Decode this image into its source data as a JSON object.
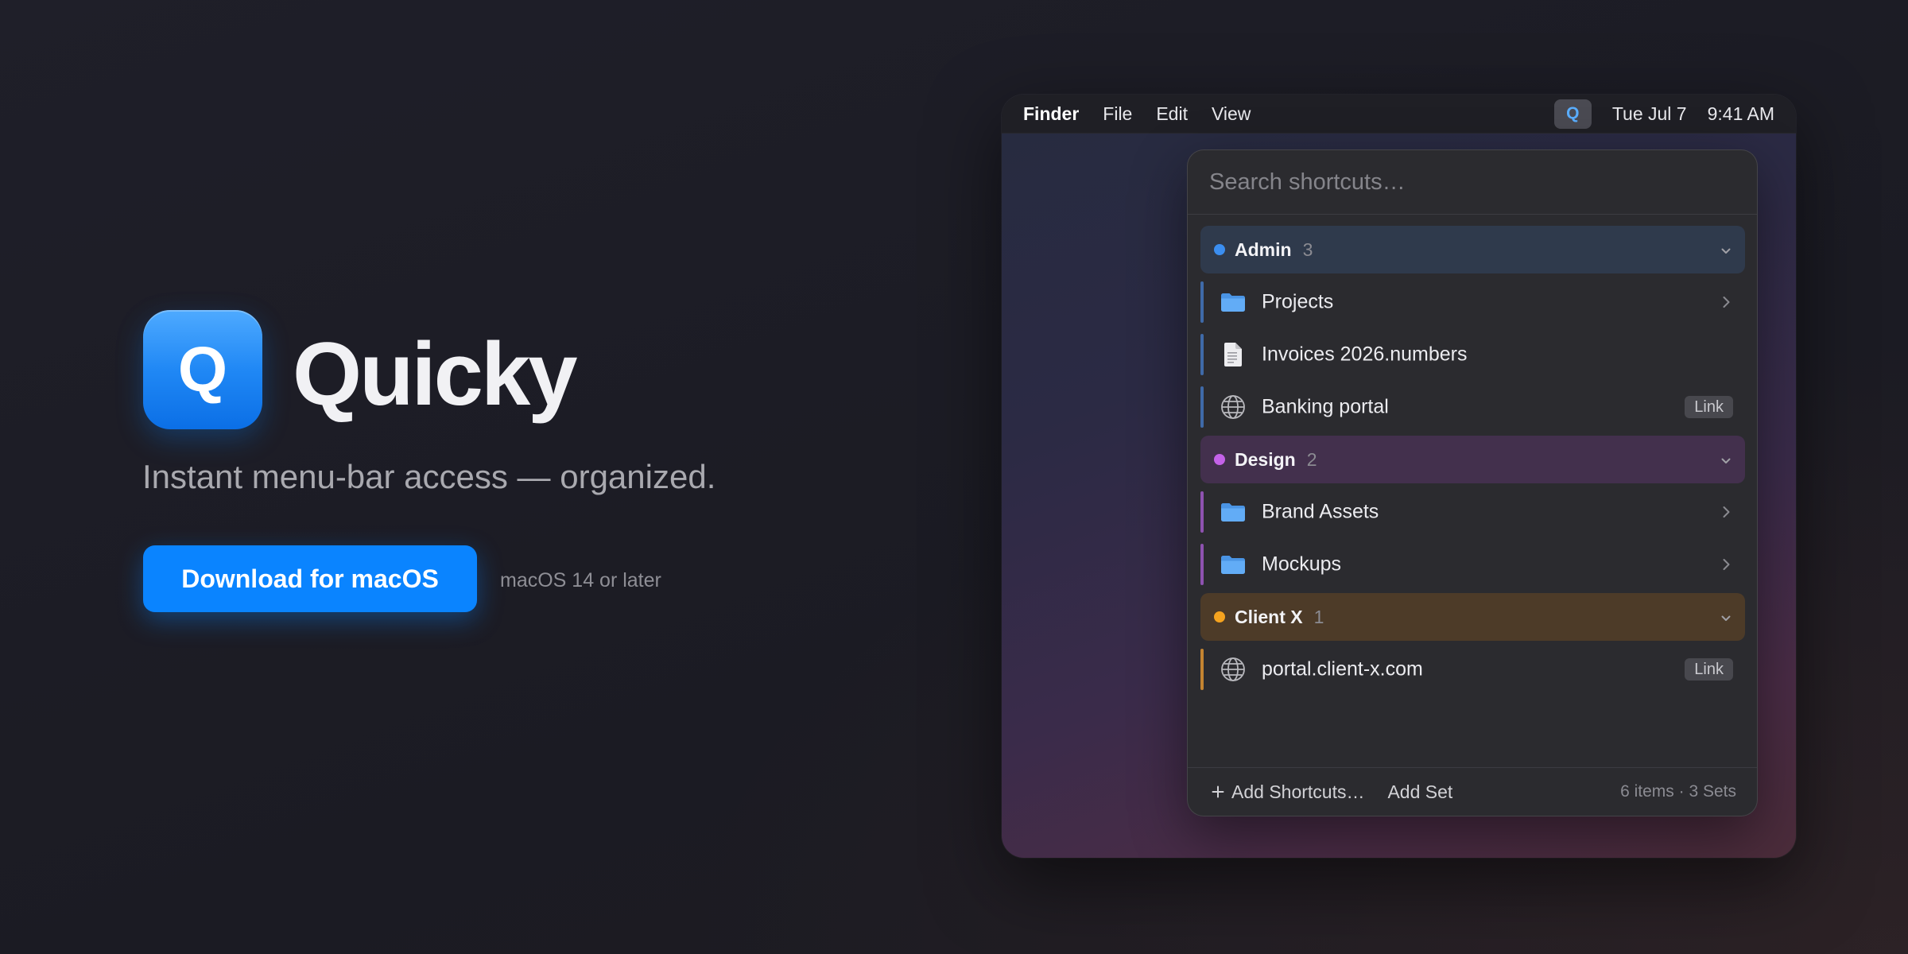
{
  "colors": {
    "accent": "#0a84ff"
  },
  "hero": {
    "app_icon": {
      "letter": "Q",
      "icon": "quicky-app-icon"
    },
    "app_name": "Quicky",
    "tagline": "Instant menu-bar access — organized.",
    "download_button": "Download for macOS",
    "requirement": "macOS 14 or later"
  },
  "menubar": {
    "app_name": "Finder",
    "menus": [
      "File",
      "Edit",
      "View"
    ],
    "status_item": {
      "letter": "Q",
      "icon": "quicky-menubar-icon"
    },
    "date": "Tue Jul 7",
    "time": "9:41 AM"
  },
  "popover": {
    "search_placeholder": "Search shortcuts…",
    "sets": [
      {
        "name": "Admin",
        "count": 3,
        "expanded": true,
        "dot_color": "#3b8ef0",
        "header_bg": "#2f3a4c",
        "bar_color": "#3f6aa8",
        "items": [
          {
            "label": "Projects",
            "icon": "folder-icon",
            "trailing_icon": "chevron-right-icon"
          },
          {
            "label": "Invoices 2026.numbers",
            "icon": "document-icon"
          },
          {
            "label": "Banking portal",
            "icon": "globe-icon",
            "badge": "Link"
          }
        ]
      },
      {
        "name": "Design",
        "count": 2,
        "expanded": true,
        "dot_color": "#c462e8",
        "header_bg": "#43304d",
        "bar_color": "#8e52b0",
        "items": [
          {
            "label": "Brand Assets",
            "icon": "folder-icon",
            "trailing_icon": "chevron-right-icon"
          },
          {
            "label": "Mockups",
            "icon": "folder-icon",
            "trailing_icon": "chevron-right-icon"
          }
        ]
      },
      {
        "name": "Client X",
        "count": 1,
        "expanded": true,
        "dot_color": "#f5a31f",
        "header_bg": "#4d3b28",
        "bar_color": "#c48431",
        "items": [
          {
            "label": "portal.client-x.com",
            "icon": "globe-icon",
            "badge": "Link"
          }
        ]
      }
    ],
    "footer": {
      "add_shortcuts_icon": "plus-icon",
      "add_shortcuts": "Add Shortcuts…",
      "add_set": "Add Set",
      "summary": "6 items · 3 Sets"
    }
  }
}
